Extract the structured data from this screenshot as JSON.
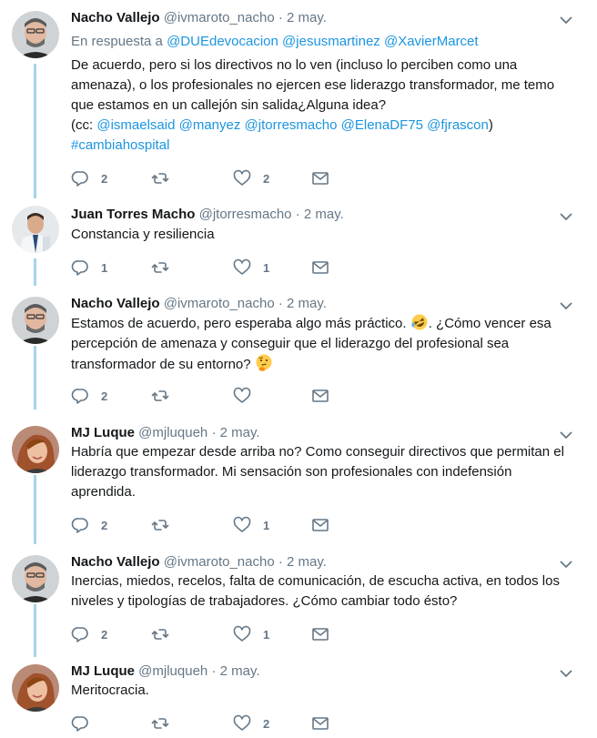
{
  "tweets": [
    {
      "name": "Nacho Vallejo",
      "handle": "@ivmaroto_nacho",
      "dot": "·",
      "time": "2 may.",
      "reply_prefix": "En respuesta a",
      "reply_mentions": [
        "@DUEdevocacion",
        "@jesusmartinez",
        "@XavierMarcet"
      ],
      "lines": [
        "De acuerdo, pero si los directivos no lo ven (incluso lo perciben como una",
        "amenaza), o los profesionales no ejercen ese liderazgo transformador, me temo",
        "que estamos en un callejón sin salida¿Alguna idea?"
      ],
      "cc_open": "(cc:",
      "cc_mentions": [
        "@ismaelsaid",
        "@manyez",
        "@jtorresmacho",
        "@ElenaDF75",
        "@fjrascon"
      ],
      "cc_close": ")",
      "hashtag": "#cambiahospital",
      "replies": "2",
      "retweets": "",
      "likes": "2"
    },
    {
      "name": "Juan Torres Macho",
      "handle": "@jtorresmacho",
      "dot": "·",
      "time": "2 may.",
      "lines": [
        "Constancia y resiliencia"
      ],
      "replies": "1",
      "retweets": "",
      "likes": "1"
    },
    {
      "name": "Nacho Vallejo",
      "handle": "@ivmaroto_nacho",
      "dot": "·",
      "time": "2 may.",
      "line1_a": "Estamos de acuerdo, pero esperaba algo más práctico.",
      "line1_b": ". ¿Cómo vencer esa",
      "line2": "percepción de amenaza y conseguir que el liderazgo del profesional sea",
      "line3": "transformador de su entorno?",
      "emoji_1": "rolling-on-floor-laughing-emoji",
      "emoji_2": "thinking-face-emoji",
      "replies": "2",
      "retweets": "",
      "likes": ""
    },
    {
      "name": "MJ Luque",
      "handle": "@mjluqueh",
      "dot": "·",
      "time": "2 may.",
      "lines": [
        "Habría que empezar desde arriba no? Como conseguir directivos que permitan el",
        "liderazgo transformador. Mi sensación son profesionales con indefensión",
        "aprendida."
      ],
      "replies": "2",
      "retweets": "",
      "likes": "1"
    },
    {
      "name": "Nacho Vallejo",
      "handle": "@ivmaroto_nacho",
      "dot": "·",
      "time": "2 may.",
      "lines": [
        "Inercias, miedos, recelos, falta de comunicación, de escucha activa, en todos los",
        "niveles y tipologías de trabajadores. ¿Cómo cambiar todo ésto?"
      ],
      "replies": "2",
      "retweets": "",
      "likes": "1"
    },
    {
      "name": "MJ Luque",
      "handle": "@mjluqueh",
      "dot": "·",
      "time": "2 may.",
      "lines": [
        "Meritocracia."
      ],
      "replies": "",
      "retweets": "",
      "likes": "2"
    }
  ],
  "colors": {
    "link": "#1b95e0",
    "muted": "#657786",
    "thread_line": "#a6d3ec",
    "separator": "#e6ecf0"
  },
  "icons": [
    "reply-icon",
    "retweet-icon",
    "like-icon",
    "direct-message-icon",
    "chevron-down-icon"
  ]
}
